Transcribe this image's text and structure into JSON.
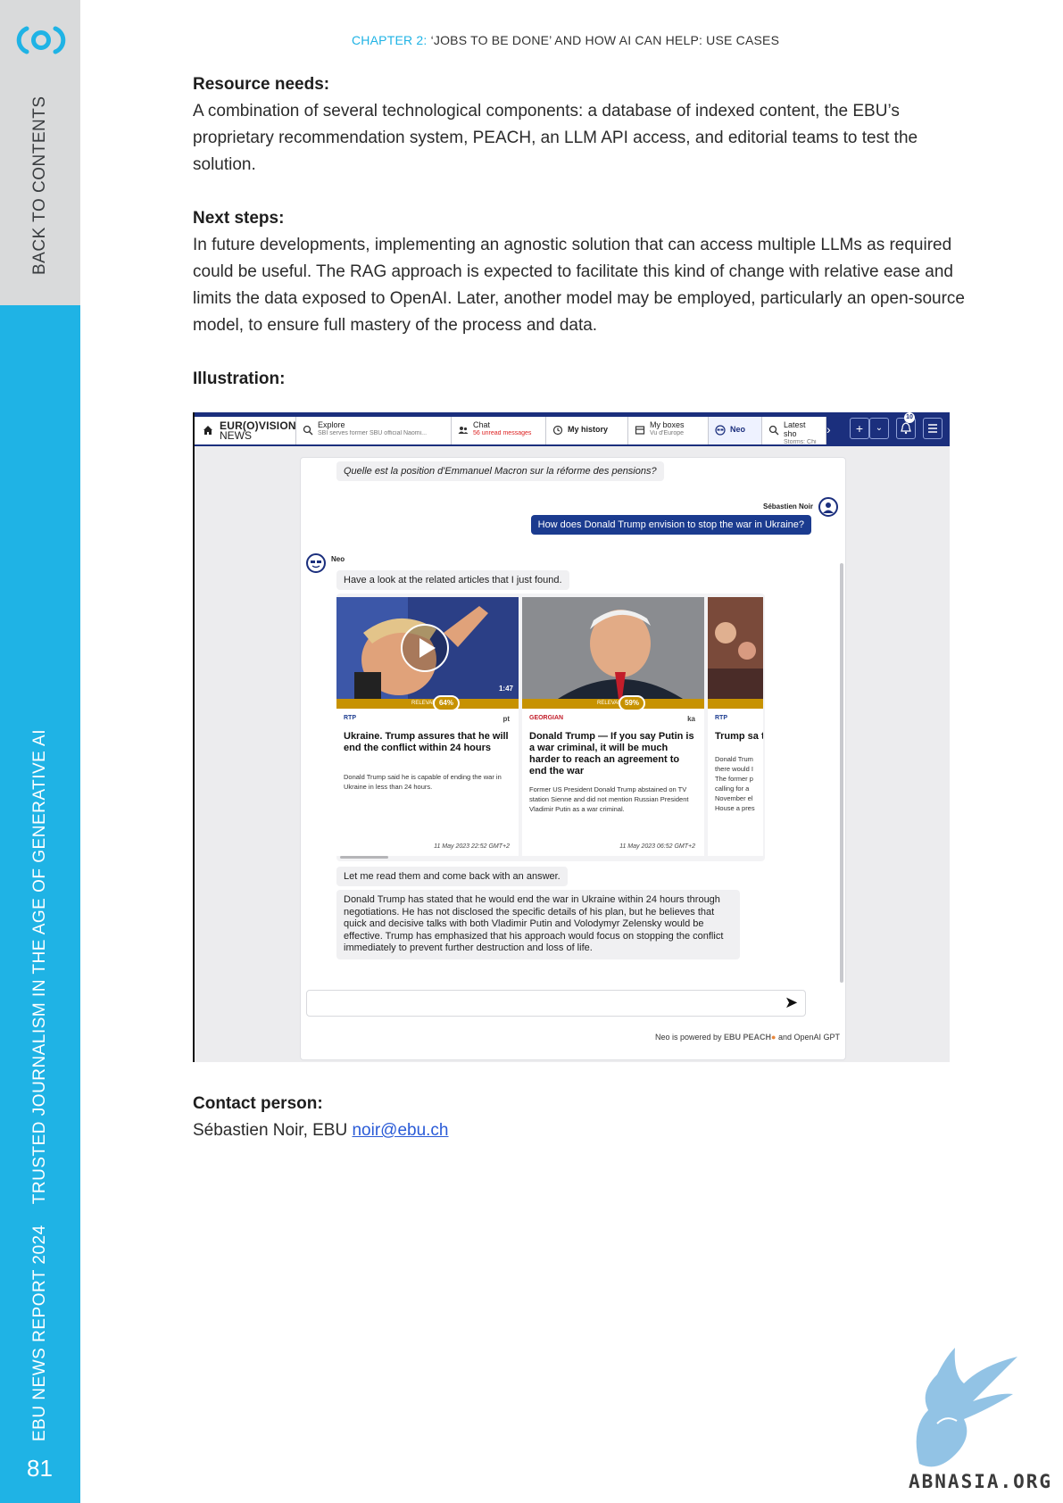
{
  "sidebar": {
    "back_to_contents": "BACK TO CONTENTS",
    "report_name": "EBU NEWS REPORT 2024",
    "report_subtitle": "TRUSTED JOURNALISM IN THE AGE OF GENERATIVE AI",
    "page_number": "81",
    "colors": {
      "top": "#d9dadb",
      "bottom": "#1fb3e5"
    }
  },
  "header": {
    "chapter_number": "CHAPTER 2:",
    "chapter_title": "‘JOBS TO BE DONE’ AND HOW AI CAN HELP: USE CASES"
  },
  "sections": {
    "resource_needs": {
      "heading": "Resource needs:",
      "text": "A combination of several technological components: a database of indexed content, the EBU’s proprietary recommendation system, PEACH, an LLM API access, and editorial teams to test the solution."
    },
    "next_steps": {
      "heading": "Next steps:",
      "text": "In future developments, implementing an agnostic solution that can access multiple LLMs as required could be useful. The RAG approach is expected to facilitate this kind of change with relative ease and limits the data exposed to OpenAI. Later, another model may be employed, particularly an open-source model, to ensure full mastery of the process and data."
    },
    "illustration": {
      "heading": "Illustration:"
    },
    "contact": {
      "heading": "Contact person:",
      "text": "Sébastien Noir, EBU ",
      "email": "noir@ebu.ch"
    }
  },
  "screenshot": {
    "tabs": {
      "home": {
        "brand_line1": "EUR(O)VISION",
        "brand_line2": "NEWS"
      },
      "explore": {
        "label": "Explore",
        "sub": "SBI serves former SBU official Naomi..."
      },
      "chat": {
        "label": "Chat",
        "sub": "56 unread messages"
      },
      "history": {
        "label": "My history"
      },
      "boxes": {
        "label": "My boxes",
        "sub": "Vu d'Europe"
      },
      "neo": {
        "label": "Neo"
      },
      "latest": {
        "label": "Latest sho",
        "sub": "Storms: Chi"
      }
    },
    "notification_count": "10",
    "chat": {
      "question_previous": "Quelle est la position d'Emmanuel Macron sur la réforme des pensions?",
      "user_name": "Sébastien Noir",
      "question": "How does Donald Trump envision to stop the war in Ukraine?",
      "bot_name": "Neo",
      "answer_intro": "Have a look at the related articles that I just found.",
      "answer_follow": "Let me read them and come back with an answer.",
      "answer_text": "Donald Trump has stated that he would end the war in Ukraine within 24 hours through negotiations. He has not disclosed the specific details of his plan, but he believes that quick and decisive talks with both Vladimir Putin and Volodymyr Zelensky would be effective. Trump has emphasized that his approach would focus on stopping the conflict immediately to prevent further destruction and loss of life.",
      "powered_prefix": "Neo is powered by ",
      "powered_peach": "EBU PEACH",
      "powered_suffix": " and OpenAI GPT"
    },
    "cards": [
      {
        "relevance_label": "RELEVANCE",
        "relevance": "64%",
        "source": "RTP",
        "lang": "pt",
        "duration": "1:47",
        "title": "Ukraine. Trump assures that he will end the conflict within 24 hours",
        "desc": "Donald Trump said he is capable of ending the war in Ukraine in less than 24 hours.",
        "date": "11 May 2023 22:52 GMT+2"
      },
      {
        "relevance_label": "RELEVANCE",
        "relevance": "59%",
        "source": "GEORGIAN",
        "lang": "ka",
        "title": "Donald Trump — If you say Putin is a war criminal, it will be much harder to reach an agreement to end the war",
        "desc": "Former US President Donald Trump abstained on TV station Sienne and did not mention Russian President Vladimir Putin as a war criminal.",
        "date": "11 May 2023 06:52 GMT+2"
      },
      {
        "source": "RTP",
        "title": "Trump sa there wou",
        "desc": "Donald Trum there would I The former p calling for a November el House a pres"
      }
    ]
  },
  "watermark": {
    "text": "ABNASIA.ORG"
  },
  "colors": {
    "accent": "#1fb3e5",
    "nav": "#1b2f7d",
    "relevance": "#c79200",
    "link": "#2a5bd7"
  }
}
